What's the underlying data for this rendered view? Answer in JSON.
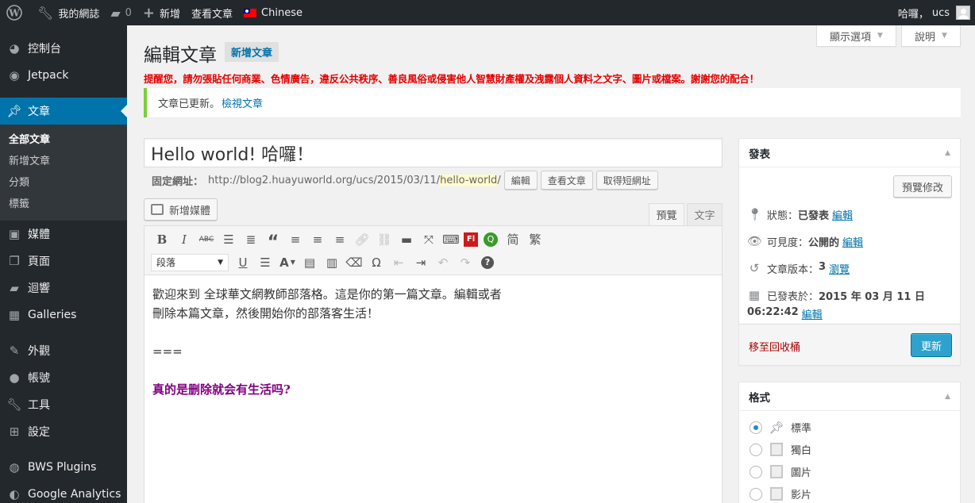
{
  "adminbar": {
    "site_name": "我的網誌",
    "comments_count": "0",
    "new_label": "新增",
    "view_post": "查看文章",
    "language": "Chinese",
    "greeting": "哈囉，",
    "username": "ucs"
  },
  "sidebar": {
    "items": [
      {
        "label": "控制台",
        "icon": "dashboard-icon"
      },
      {
        "label": "Jetpack",
        "icon": "jetpack-icon"
      },
      {
        "label": "文章",
        "icon": "pin-icon"
      },
      {
        "label": "媒體",
        "icon": "media-icon"
      },
      {
        "label": "頁面",
        "icon": "page-icon"
      },
      {
        "label": "迴響",
        "icon": "comment-icon"
      },
      {
        "label": "Galleries",
        "icon": "grid-icon"
      },
      {
        "label": "外觀",
        "icon": "brush-icon"
      },
      {
        "label": "帳號",
        "icon": "user-icon"
      },
      {
        "label": "工具",
        "icon": "wrench-icon"
      },
      {
        "label": "設定",
        "icon": "settings-icon"
      },
      {
        "label": "BWS Plugins",
        "icon": "plugin-icon"
      },
      {
        "label": "Google Analytics",
        "icon": "analytics-icon"
      }
    ],
    "submenu": [
      "全部文章",
      "新增文章",
      "分類",
      "標籤"
    ]
  },
  "screen_meta": {
    "options_label": "顯示選項",
    "help_label": "說明"
  },
  "page": {
    "title": "編輯文章",
    "add_new": "新增文章",
    "warning": "提醒您，請勿張貼任何商業、色情廣告，違反公共秩序、善良風俗或侵害他人智慧財產權及洩露個人資料之文字、圖片或檔案。謝謝您的配合！",
    "notice_text": "文章已更新。",
    "notice_link": "檢視文章"
  },
  "post": {
    "title": "Hello world! 哈囉！",
    "permalink_label": "固定網址：",
    "permalink_base": "http://blog2.huayuworld.org/ucs/2015/03/11/",
    "permalink_slug": "hello-world",
    "permalink_tail": "/",
    "edit_btn": "編輯",
    "view_btn": "查看文章",
    "shortlink_btn": "取得短網址"
  },
  "editor": {
    "add_media": "新增媒體",
    "tab_visual": "預覽",
    "tab_text": "文字",
    "format_value": "段落",
    "toolbar_simplified": "简",
    "toolbar_traditional": "繁",
    "content": {
      "line1": "歡迎來到 全球華文網教師部落格。這是你的第一篇文章。編輯或者",
      "line2": "刪除本篇文章，然後開始你的部落客生活！",
      "line3": "===",
      "line4": "真的是删除就会有生活吗?"
    }
  },
  "publish": {
    "title": "發表",
    "preview_btn": "預覽修改",
    "status_label": "狀態：",
    "status_value": "已發表",
    "status_edit": "編輯",
    "visibility_label": "可見度：",
    "visibility_value": "公開的",
    "visibility_edit": "編輯",
    "revisions_label": "文章版本：",
    "revisions_count": "3",
    "revisions_link": "瀏覽",
    "published_label": "已發表於：",
    "published_value": "2015 年 03 月 11 日",
    "published_time": "06:22:42",
    "published_edit": "編輯",
    "trash_link": "移至回收桶",
    "update_btn": "更新"
  },
  "formats": {
    "title": "格式",
    "options": [
      {
        "label": "標準",
        "selected": true
      },
      {
        "label": "獨白",
        "selected": false
      },
      {
        "label": "圖片",
        "selected": false
      },
      {
        "label": "影片",
        "selected": false
      }
    ]
  },
  "colors": {
    "accent": "#0073aa",
    "warning": "#e60000",
    "notice_border": "#7ad03a",
    "update_button": "#2ea2cc",
    "adminbar_bg": "#23282d"
  }
}
